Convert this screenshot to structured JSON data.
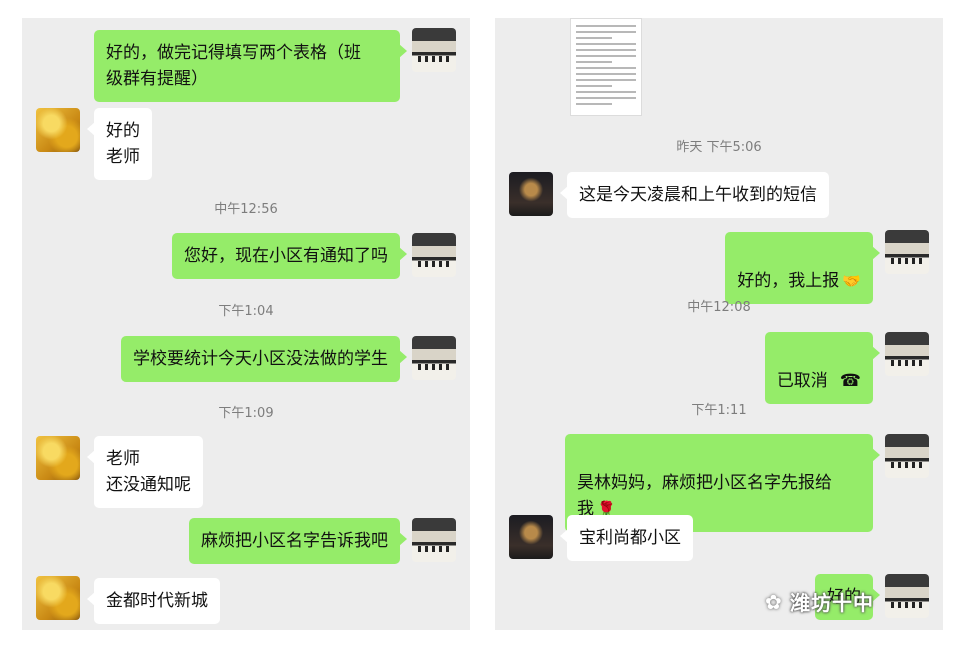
{
  "left": {
    "messages": [
      {
        "side": "sent",
        "text": "好的，做完记得填写两个表格（班\n级群有提醒）"
      },
      {
        "side": "recv",
        "text": "好的\n老师"
      },
      {
        "time": "中午12:56"
      },
      {
        "side": "sent",
        "text": "您好，现在小区有通知了吗"
      },
      {
        "time": "下午1:04"
      },
      {
        "side": "sent",
        "text": "学校要统计今天小区没法做的学生"
      },
      {
        "time": "下午1:09"
      },
      {
        "side": "recv",
        "text": "老师\n还没通知呢"
      },
      {
        "side": "sent",
        "text": "麻烦把小区名字告诉我吧"
      },
      {
        "side": "recv",
        "text": "金都时代新城"
      }
    ]
  },
  "right": {
    "messages": [
      {
        "time": "昨天 下午5:06"
      },
      {
        "side": "recv",
        "text": "这是今天凌晨和上午收到的短信"
      },
      {
        "side": "sent",
        "text": "好的，我上报",
        "emoji": "handshake-emoji"
      },
      {
        "time": "中午12:08"
      },
      {
        "side": "sent",
        "text": "已取消",
        "icon": "phone-hangup-icon"
      },
      {
        "time": "下午1:11"
      },
      {
        "side": "sent",
        "text": "昊林妈妈，麻烦把小区名字先报给\n我",
        "emoji": "rose-emoji"
      },
      {
        "side": "recv",
        "text": "宝利尚都小区"
      },
      {
        "side": "sent",
        "text": "好的"
      }
    ]
  },
  "watermark": "潍坊十中",
  "colors": {
    "sent_bubble": "#95ec69",
    "recv_bubble": "#ffffff",
    "panel_bg": "#ededed"
  }
}
